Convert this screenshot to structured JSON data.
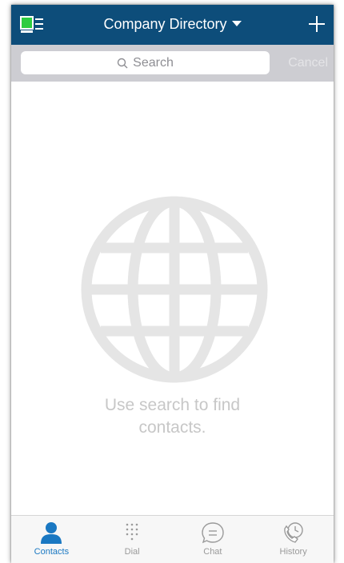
{
  "navbar": {
    "title": "Company Directory",
    "menu_icon": "contacts-list-icon",
    "add_icon": "plus-icon"
  },
  "search": {
    "placeholder": "Search",
    "cancel_label": "Cancel"
  },
  "empty_state": {
    "icon": "globe-icon",
    "message": "Use search to find contacts."
  },
  "tabs": [
    {
      "label": "Contacts",
      "icon": "person-icon",
      "active": true
    },
    {
      "label": "Dial",
      "icon": "dialpad-icon",
      "active": false
    },
    {
      "label": "Chat",
      "icon": "chat-bubble-icon",
      "active": false
    },
    {
      "label": "History",
      "icon": "phone-history-icon",
      "active": false
    }
  ],
  "colors": {
    "navbar": "#0d4d7a",
    "menu_icon_accent": "#2ecc40",
    "active_tab": "#1a78c2",
    "inactive_tab": "#9a9a9a",
    "search_bar": "#cdcdd2",
    "empty_text": "#c7c7c7"
  }
}
